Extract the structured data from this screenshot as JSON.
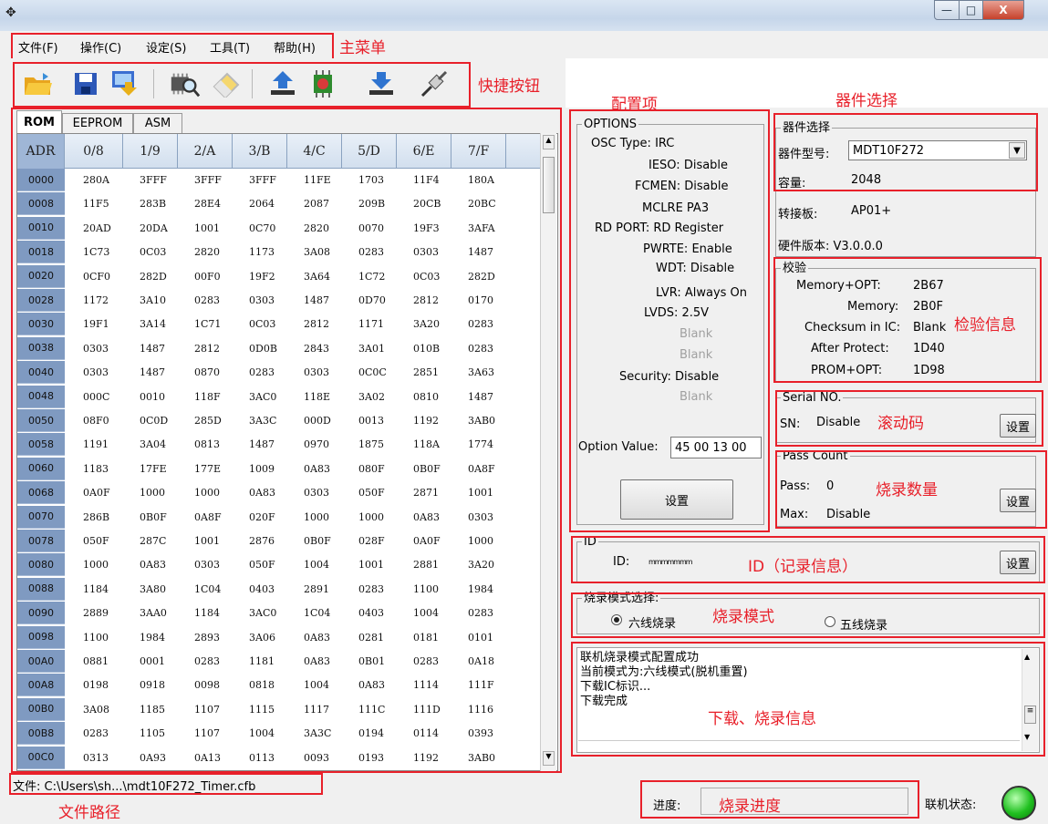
{
  "window": {
    "icon": "app-icon",
    "minimize": "—",
    "maximize": "□",
    "close": "X"
  },
  "menu": [
    {
      "label": "文件(F)"
    },
    {
      "label": "操作(C)"
    },
    {
      "label": "设定(S)"
    },
    {
      "label": "工具(T)"
    },
    {
      "label": "帮助(H)"
    }
  ],
  "toolbar_icons": [
    "open-folder-icon",
    "save-icon",
    "export-icon",
    "read-chip-icon",
    "erase-icon",
    "upload-icon",
    "chip-icon",
    "download-icon",
    "connect-icon"
  ],
  "tabs": [
    "ROM",
    "EEPROM",
    "ASM"
  ],
  "table": {
    "headers": [
      "ADR",
      "0/8",
      "1/9",
      "2/A",
      "3/B",
      "4/C",
      "5/D",
      "6/E",
      "7/F"
    ],
    "rows": [
      {
        "adr": "0000",
        "cells": [
          "280A",
          "3FFF",
          "3FFF",
          "3FFF",
          "11FE",
          "1703",
          "11F4",
          "180A"
        ]
      },
      {
        "adr": "0008",
        "cells": [
          "11F5",
          "283B",
          "28E4",
          "2064",
          "2087",
          "209B",
          "20CB",
          "20BC"
        ]
      },
      {
        "adr": "0010",
        "cells": [
          "20AD",
          "20DA",
          "1001",
          "0C70",
          "2820",
          "0070",
          "19F3",
          "3AFA"
        ]
      },
      {
        "adr": "0018",
        "cells": [
          "1C73",
          "0C03",
          "2820",
          "1173",
          "3A08",
          "0283",
          "0303",
          "1487"
        ]
      },
      {
        "adr": "0020",
        "cells": [
          "0CF0",
          "282D",
          "00F0",
          "19F2",
          "3A64",
          "1C72",
          "0C03",
          "282D"
        ]
      },
      {
        "adr": "0028",
        "cells": [
          "1172",
          "3A10",
          "0283",
          "0303",
          "1487",
          "0D70",
          "2812",
          "0170"
        ]
      },
      {
        "adr": "0030",
        "cells": [
          "19F1",
          "3A14",
          "1C71",
          "0C03",
          "2812",
          "1171",
          "3A20",
          "0283"
        ]
      },
      {
        "adr": "0038",
        "cells": [
          "0303",
          "1487",
          "2812",
          "0D0B",
          "2843",
          "3A01",
          "010B",
          "0283"
        ]
      },
      {
        "adr": "0040",
        "cells": [
          "0303",
          "1487",
          "0870",
          "0283",
          "0303",
          "0C0C",
          "2851",
          "3A63"
        ]
      },
      {
        "adr": "0048",
        "cells": [
          "000C",
          "0010",
          "118F",
          "3AC0",
          "118E",
          "3A02",
          "0810",
          "1487"
        ]
      },
      {
        "adr": "0050",
        "cells": [
          "08F0",
          "0C0D",
          "285D",
          "3A3C",
          "000D",
          "0013",
          "1192",
          "3AB0"
        ]
      },
      {
        "adr": "0058",
        "cells": [
          "1191",
          "3A04",
          "0813",
          "1487",
          "0970",
          "1875",
          "118A",
          "1774"
        ]
      },
      {
        "adr": "0060",
        "cells": [
          "1183",
          "17FE",
          "177E",
          "1009",
          "0A83",
          "080F",
          "0B0F",
          "0A8F"
        ]
      },
      {
        "adr": "0068",
        "cells": [
          "0A0F",
          "1000",
          "1000",
          "0A83",
          "0303",
          "050F",
          "2871",
          "1001"
        ]
      },
      {
        "adr": "0070",
        "cells": [
          "286B",
          "0B0F",
          "0A8F",
          "020F",
          "1000",
          "1000",
          "0A83",
          "0303"
        ]
      },
      {
        "adr": "0078",
        "cells": [
          "050F",
          "287C",
          "1001",
          "2876",
          "0B0F",
          "028F",
          "0A0F",
          "1000"
        ]
      },
      {
        "adr": "0080",
        "cells": [
          "1000",
          "0A83",
          "0303",
          "050F",
          "1004",
          "1001",
          "2881",
          "3A20"
        ]
      },
      {
        "adr": "0088",
        "cells": [
          "1184",
          "3A80",
          "1C04",
          "0403",
          "2891",
          "0283",
          "1100",
          "1984"
        ]
      },
      {
        "adr": "0090",
        "cells": [
          "2889",
          "3AA0",
          "1184",
          "3AC0",
          "1C04",
          "0403",
          "1004",
          "0283"
        ]
      },
      {
        "adr": "0098",
        "cells": [
          "1100",
          "1984",
          "2893",
          "3A06",
          "0A83",
          "0281",
          "0181",
          "0101"
        ]
      },
      {
        "adr": "00A0",
        "cells": [
          "0881",
          "0001",
          "0283",
          "1181",
          "0A83",
          "0B01",
          "0283",
          "0A18"
        ]
      },
      {
        "adr": "00A8",
        "cells": [
          "0198",
          "0918",
          "0098",
          "0818",
          "1004",
          "0A83",
          "1114",
          "111F"
        ]
      },
      {
        "adr": "00B0",
        "cells": [
          "3A08",
          "1185",
          "1107",
          "1115",
          "1117",
          "111C",
          "111D",
          "1116"
        ]
      },
      {
        "adr": "00B8",
        "cells": [
          "0283",
          "1105",
          "1107",
          "1004",
          "3A3C",
          "0194",
          "0114",
          "0393"
        ]
      },
      {
        "adr": "00C0",
        "cells": [
          "0313",
          "0A93",
          "0A13",
          "0113",
          "0093",
          "0193",
          "1192",
          "3AB0"
        ]
      }
    ]
  },
  "file_path": "文件: C:\\Users\\sh...\\mdt10F272_Timer.cfb",
  "options": {
    "title": "OPTIONS",
    "lines": [
      {
        "text": "OSC Type: IRC"
      },
      {
        "text": "IESO: Disable"
      },
      {
        "text": "FCMEN: Disable"
      },
      {
        "text": "MCLRE PA3"
      },
      {
        "text": "RD PORT: RD Register"
      },
      {
        "text": "PWRTE: Enable"
      },
      {
        "text": "WDT: Disable"
      },
      {
        "text": "LVR: Always On"
      },
      {
        "text": "LVDS: 2.5V"
      },
      {
        "text": "Blank"
      },
      {
        "text": "Blank"
      },
      {
        "text": "Security: Disable"
      },
      {
        "text": "Blank"
      }
    ],
    "value_label": "Option Value:",
    "value": "45 00 13 00",
    "set_button": "设置"
  },
  "device": {
    "title": "器件选择",
    "model_label": "器件型号:",
    "model_value": "MDT10F272",
    "capacity_label": "容量:",
    "capacity_value": "2048",
    "adapter_label": "转接板:",
    "adapter_value": "AP01+",
    "hw_label": "硬件版本: V3.0.0.0"
  },
  "checksum": {
    "title": "校验",
    "rows": [
      {
        "label": "Memory+OPT:",
        "value": "2B67"
      },
      {
        "label": "Memory:",
        "value": "2B0F"
      },
      {
        "label": "Checksum in IC:",
        "value": "Blank"
      },
      {
        "label": "After Protect:",
        "value": "1D40"
      },
      {
        "label": "PROM+OPT:",
        "value": "1D98"
      }
    ]
  },
  "serial": {
    "title": "Serial NO.",
    "sn_label": "SN:",
    "sn_value": "Disable",
    "button": "设置"
  },
  "pass": {
    "title": "Pass Count",
    "pass_label": "Pass:",
    "pass_value": "0",
    "max_label": "Max:",
    "max_value": "Disable",
    "button": "设置"
  },
  "id": {
    "title": "ID",
    "label": "ID:",
    "value": "mmmmmmm",
    "button": "设置"
  },
  "mode": {
    "title": "烧录模式选择:",
    "opt1": "六线烧录",
    "opt2": "五线烧录",
    "selected": "opt1"
  },
  "log": [
    "联机烧录模式配置成功",
    "当前模式为:六线模式(脱机重置)",
    "下载IC标识...",
    "下载完成"
  ],
  "status": {
    "progress_label": "进度:",
    "conn_label": "联机状态:",
    "conn_color": "#20c020"
  },
  "annotations": {
    "main_menu": "主菜单",
    "shortcut": "快捷按钮",
    "config": "配置项",
    "device_select": "器件选择",
    "checksum_info": "检验信息",
    "rolling_code": "滚动码",
    "burn_count": "烧录数量",
    "id_info": "ID（记录信息）",
    "burn_mode": "烧录模式",
    "download_info": "下载、烧录信息",
    "file_path": "文件路径",
    "progress": "烧录进度"
  },
  "colors": {
    "annotation": "#e8202a",
    "adr_col": "#7f9ac1",
    "header": "#dbe5f1"
  }
}
